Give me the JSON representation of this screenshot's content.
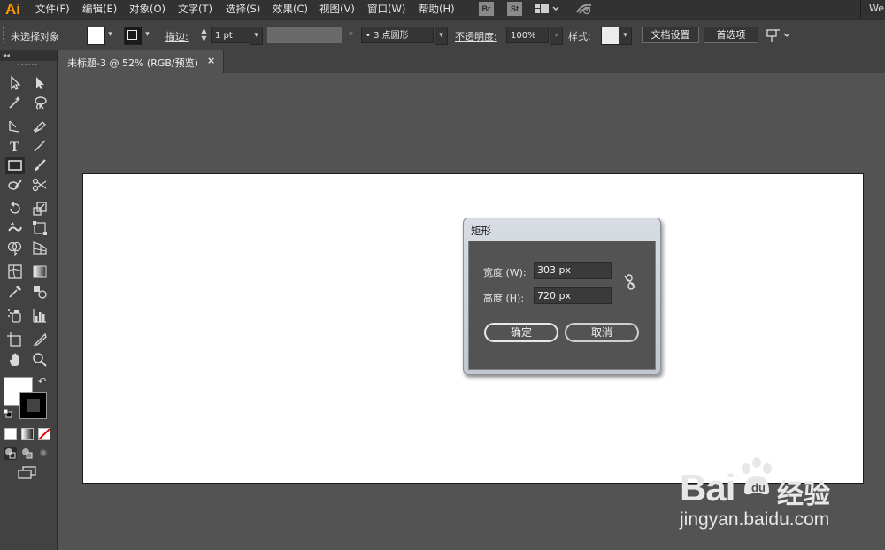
{
  "app": {
    "logo": "Ai"
  },
  "menubar": {
    "items": [
      "文件(F)",
      "编辑(E)",
      "对象(O)",
      "文字(T)",
      "选择(S)",
      "效果(C)",
      "视图(V)",
      "窗口(W)",
      "帮助(H)"
    ],
    "bridge_label": "Br",
    "stock_label": "St",
    "right_text": "We"
  },
  "controlbar": {
    "selection_status": "未选择对象",
    "stroke_label": "描边:",
    "stroke_weight": "1 pt",
    "brush_definition": "• 3 点圆形",
    "opacity_label": "不透明度:",
    "opacity_value": "100%",
    "style_label": "样式:",
    "doc_setup_button": "文档设置",
    "preferences_button": "首选项"
  },
  "document_tab": {
    "title": "未标题-3 @ 52% (RGB/预览)",
    "close": "×"
  },
  "dialog": {
    "title": "矩形",
    "width_label": "宽度 (W):",
    "width_value": "303 px",
    "height_label": "高度 (H):",
    "height_value": "720 px",
    "ok_button": "确定",
    "cancel_button": "取消"
  },
  "watermark": {
    "brand": "Bai",
    "brand_suffix": "经验",
    "url": "jingyan.baidu.com"
  },
  "colors": {
    "app_bg": "#535353",
    "menubar_bg": "#323232",
    "panel_bg": "#424242",
    "logo_orange": "#ff9a00",
    "artboard": "#ffffff"
  }
}
